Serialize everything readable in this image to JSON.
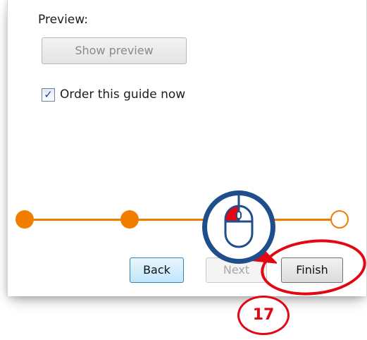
{
  "preview": {
    "label": "Preview:",
    "button_label": "Show preview"
  },
  "order": {
    "checked": true,
    "label": "Order this guide now"
  },
  "progress": {
    "steps_total": 4,
    "steps_completed": 3,
    "color": "#f07d00"
  },
  "nav": {
    "back_label": "Back",
    "next_label": "Next",
    "finish_label": "Finish"
  },
  "tutorial": {
    "step_number": "17",
    "highlight_color": "#e30613",
    "pointer_icon": "mouse-left-click-icon"
  }
}
